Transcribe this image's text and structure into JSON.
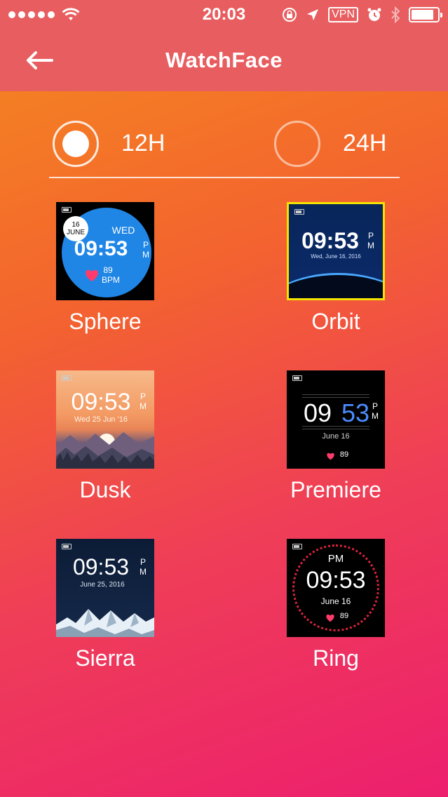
{
  "status_bar": {
    "time": "20:03",
    "vpn": "VPN"
  },
  "nav": {
    "title": "WatchFace"
  },
  "time_format": {
    "option_12h": "12H",
    "option_24h": "24H",
    "selected": "12H"
  },
  "faces": [
    {
      "name": "Sphere",
      "day_num": "16",
      "month": "JUNE",
      "weekday": "WED",
      "time": "09:53",
      "ampm_p": "P",
      "ampm_m": "M",
      "bpm_value": "89",
      "bpm_unit": "BPM"
    },
    {
      "name": "Orbit",
      "time": "09:53",
      "ampm_p": "P",
      "ampm_m": "M",
      "date": "Wed, June 16, 2016"
    },
    {
      "name": "Dusk",
      "time": "09:53",
      "ampm_p": "P",
      "ampm_m": "M",
      "date": "Wed 25 Jun '16"
    },
    {
      "name": "Premiere",
      "hour": "09",
      "minute": "53",
      "ampm_p": "P",
      "ampm_m": "M",
      "date": "June 16",
      "bpm_value": "89"
    },
    {
      "name": "Sierra",
      "time": "09:53",
      "ampm_p": "P",
      "ampm_m": "M",
      "date": "June 25, 2016"
    },
    {
      "name": "Ring",
      "ampm": "PM",
      "time": "09:53",
      "date": "June 16",
      "bpm_value": "89"
    }
  ],
  "selected_face": "Orbit",
  "colors": {
    "header": "#e85d5f",
    "gradient_top": "#f5891f",
    "gradient_bottom": "#ed1f6e",
    "selection_border": "#f2e300",
    "heart": "#ff3b6b"
  }
}
